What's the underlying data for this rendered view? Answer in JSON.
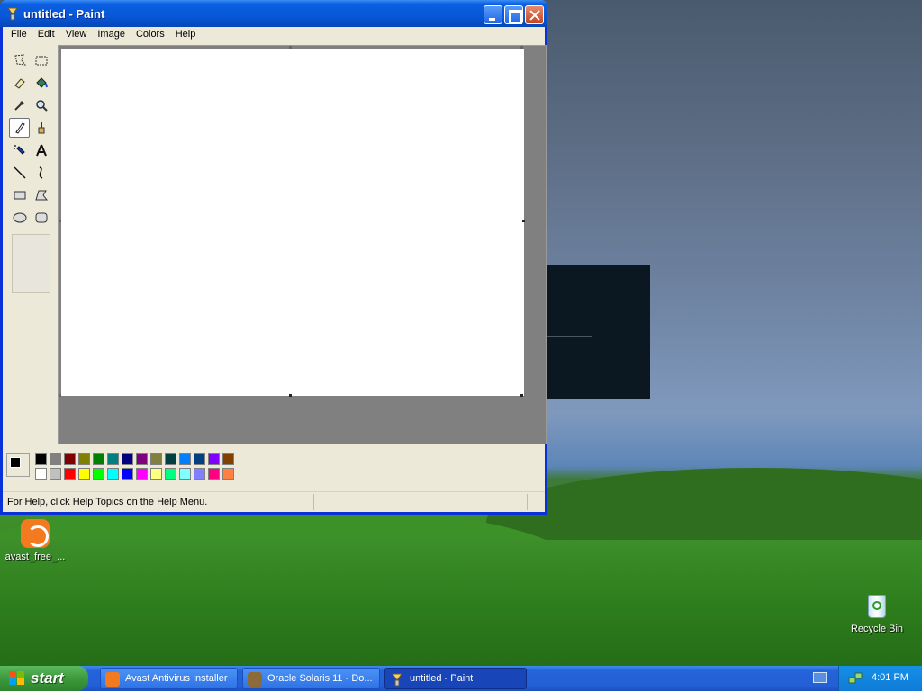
{
  "window": {
    "title": "untitled - Paint",
    "menus": [
      "File",
      "Edit",
      "View",
      "Image",
      "Colors",
      "Help"
    ],
    "status_text": "For Help, click Help Topics on the Help Menu.",
    "selected_tool": "pencil",
    "palette_top": [
      "#000000",
      "#808080",
      "#800000",
      "#808000",
      "#008000",
      "#008080",
      "#000080",
      "#800080",
      "#808040",
      "#004040",
      "#0080ff",
      "#004080",
      "#8000ff",
      "#804000"
    ],
    "palette_bottom": [
      "#ffffff",
      "#c0c0c0",
      "#ff0000",
      "#ffff00",
      "#00ff00",
      "#00ffff",
      "#0000ff",
      "#ff00ff",
      "#ffff80",
      "#00ff80",
      "#80ffff",
      "#8080ff",
      "#ff0080",
      "#ff8040"
    ],
    "foreground_color": "#000000",
    "background_color": "#ffffff"
  },
  "desktop": {
    "icons": [
      {
        "label": "avast_free_...",
        "icon": "avast-icon"
      },
      {
        "label": "Recycle Bin",
        "icon": "recycle-bin-icon"
      }
    ]
  },
  "taskbar": {
    "start_label": "start",
    "tasks": [
      {
        "label": "Avast Antivirus Installer",
        "icon": "avast-icon",
        "active": false
      },
      {
        "label": "Oracle Solaris 11 - Do...",
        "icon": "browser-icon",
        "active": false
      },
      {
        "label": "untitled - Paint",
        "icon": "paint-icon",
        "active": true
      }
    ],
    "clock": "4:01 PM"
  }
}
